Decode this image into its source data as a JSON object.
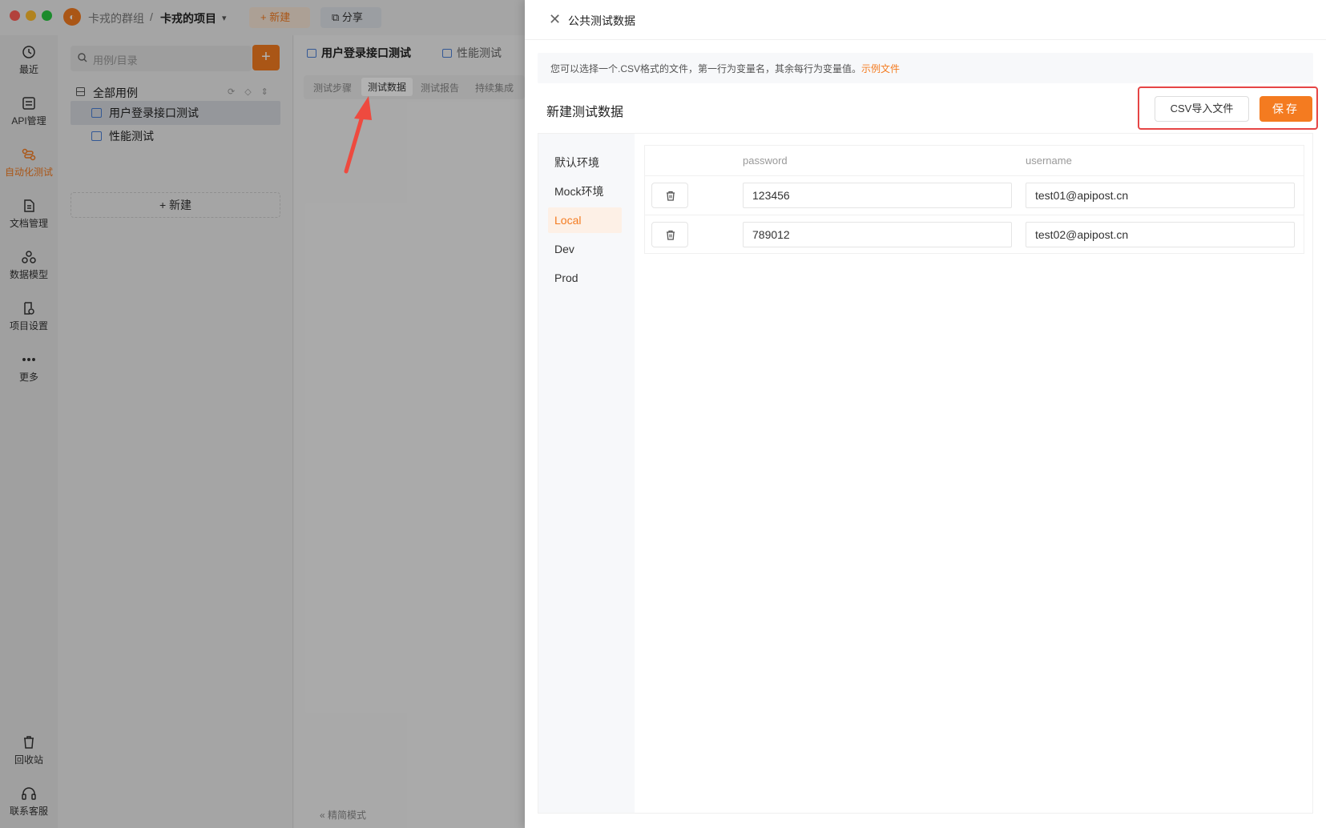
{
  "titlebar": {
    "group": "卡戎的群组",
    "separator": "/",
    "project": "卡戎的项目",
    "new_label": "+ 新建",
    "share_label": "分享"
  },
  "rail": {
    "items": [
      {
        "label": "最近",
        "icon": "clock-icon"
      },
      {
        "label": "API管理",
        "icon": "api-icon"
      },
      {
        "label": "自动化测试",
        "icon": "automation-icon",
        "active": true
      },
      {
        "label": "文档管理",
        "icon": "document-icon"
      },
      {
        "label": "数据模型",
        "icon": "model-icon"
      },
      {
        "label": "项目设置",
        "icon": "settings-icon"
      },
      {
        "label": "更多",
        "icon": "more-icon"
      }
    ],
    "bottom": [
      {
        "label": "回收站",
        "icon": "trash-icon"
      },
      {
        "label": "联系客服",
        "icon": "headset-icon"
      }
    ]
  },
  "tree": {
    "search_placeholder": "用例/目录",
    "add_label": "+",
    "root_label": "全部用例",
    "items": [
      {
        "label": "用户登录接口测试",
        "selected": true
      },
      {
        "label": "性能测试",
        "selected": false
      }
    ],
    "new_label": "+ 新建"
  },
  "main": {
    "tabs": [
      "用户登录接口测试",
      "性能测试"
    ],
    "subtabs": [
      "测试步骤",
      "测试数据",
      "测试报告",
      "持续集成"
    ],
    "active_subtab": "测试数据",
    "footer_mode": "« 精简模式"
  },
  "drawer": {
    "title": "公共测试数据",
    "close": "✕",
    "tip_text": "您可以选择一个.CSV格式的文件，第一行为变量名，其余每行为变量值。",
    "tip_link": "示例文件",
    "section_title": "新建测试数据",
    "csv_button": "CSV导入文件",
    "save_button": "保存",
    "envs": [
      "默认环境",
      "Mock环境",
      "Local",
      "Dev",
      "Prod"
    ],
    "active_env": "Local",
    "columns": [
      "password",
      "username"
    ],
    "rows": [
      {
        "password": "123456",
        "username": "test01@apipost.cn"
      },
      {
        "password": "789012",
        "username": "test02@apipost.cn"
      }
    ]
  },
  "colors": {
    "accent": "#f47b20",
    "highlight_border": "#e64545",
    "link_blue": "#4a7fd6"
  }
}
